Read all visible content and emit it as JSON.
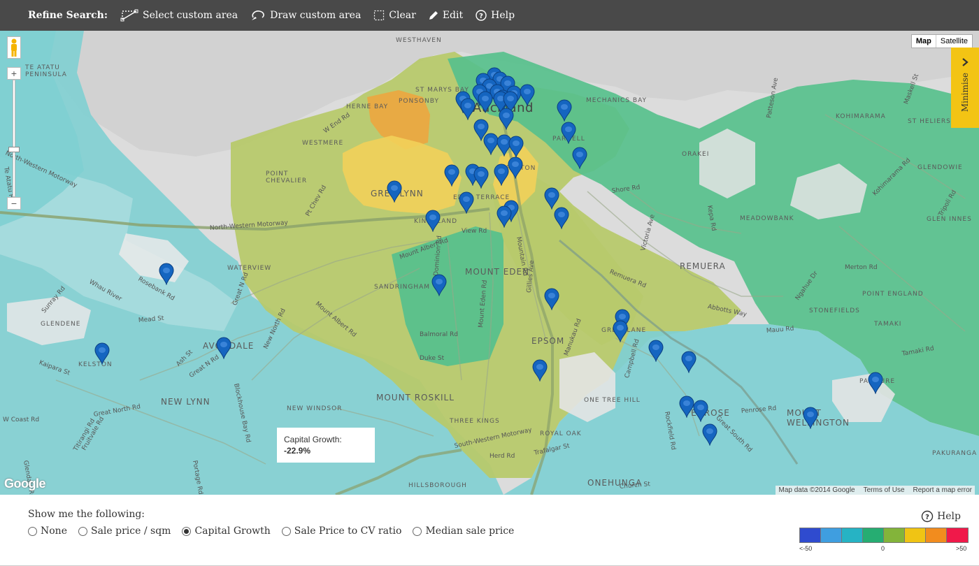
{
  "toolbar": {
    "title": "Refine Search:",
    "tools": [
      {
        "label": "Select custom area",
        "icon": "select-area-icon"
      },
      {
        "label": "Draw custom area",
        "icon": "draw-area-icon"
      },
      {
        "label": "Clear",
        "icon": "clear-icon"
      },
      {
        "label": "Edit",
        "icon": "pencil-icon"
      },
      {
        "label": "Help",
        "icon": "help-icon"
      }
    ]
  },
  "map": {
    "map_type": {
      "map": "Map",
      "satellite": "Satellite",
      "selected": "Map"
    },
    "minimise_label": "Minimise",
    "zoom": {
      "in": "+",
      "out": "−"
    },
    "tooltip": {
      "label": "Capital Growth:",
      "value": "-22.9%"
    },
    "google_logo": "Google",
    "attribution": [
      "Map data ©2014 Google",
      "Terms of Use",
      "Report a map error"
    ],
    "places": {
      "auckland": "Auckland",
      "grey_lynn": "GREY LYNN",
      "mount_eden": "MOUNT EDEN",
      "remuera": "REMUERA",
      "avondale": "AVONDALE",
      "new_lynn": "NEW LYNN",
      "mount_roskill": "MOUNT ROSKILL",
      "mount_wellington": "MOUNT\nWELLINGTON",
      "epsom": "EPSOM",
      "penrose": "PENROSE",
      "ponsonby": "PONSONBY",
      "westmere": "WESTMERE",
      "parnell": "PARNELL",
      "grafton": "GRAFTON",
      "eden_terrace": "EDEN TERRACE",
      "kingsland": "KINGSLAND",
      "sandringham": "SANDRINGHAM",
      "greenlane": "GREENLANE",
      "one_tree_hill": "ONE TREE HILL",
      "three_kings": "THREE KINGS",
      "royal_oak": "ROYAL OAK",
      "onehunga": "ONEHUNGA",
      "hillsborough": "HILLSBOROUGH",
      "new_windsor": "NEW WINDSOR",
      "kelston": "KELSTON",
      "glendene": "GLENDENE",
      "waterview": "WATERVIEW",
      "point_chevalier": "POINT\nCHEVALIER",
      "te_atatu_peninsula": "TE ATATU\nPENINSULA",
      "westhaven": "WESTHAVEN",
      "herne_bay": "HERNE BAY",
      "st_marys_bay": "ST MARYS BAY",
      "mechanics_bay": "MECHANICS BAY",
      "orakei": "ORAKEI",
      "kohimarama": "KOHIMARAMA",
      "st_heliers": "ST HELIERS",
      "glendowie": "GLENDOWIE",
      "meadowbank": "MEADOWBANK",
      "stonefields": "STONEFIELDS",
      "point_england": "POINT ENGLAND",
      "panmure": "PANMURE",
      "glen_innes": "GLEN INNES",
      "pakuranga": "PAKURANGA",
      "tamaki": "TAMAKI"
    },
    "streets": {
      "nw_motorway_1": "North-Western Motorway",
      "nw_motorway_2": "North-Western Motorway",
      "great_north_rd": "Great N Rd",
      "great_north_rd_2": "Great N Rd",
      "great_north_rd_3": "Great North Rd",
      "new_north_rd": "New North Rd",
      "mount_albert_rd": "Mount Albert Rd",
      "dominion_rd": "Dominion Rd",
      "mount_eden_rd": "Mount Eden Rd",
      "gillies_ave": "Gillies Ave",
      "manukau_rd": "Manukau Rd",
      "mountain_rd": "Mountain Rd",
      "remuera_rd": "Remuera Rd",
      "shore_rd": "Shore Rd",
      "victoria_ave": "Victoria Ave",
      "abbotts_way": "Abbotts Way",
      "campbell_rd": "Campbell Rd",
      "penrose_rd": "Penrose Rd",
      "mount_albert_rd_2": "Mount Albert Rd",
      "view_rd": "View Rd",
      "balmoral": "Balmoral Rd",
      "duke_st": "Duke St",
      "herd_rd": "Herd Rd",
      "trafalgar_st": "Trafalgar St",
      "church_st": "Church St",
      "merton_rd": "Merton Rd",
      "tamaki_rd": "Tamaki Rd",
      "rosebank_rd": "Rosebank Rd",
      "whau_river": "Whau River",
      "ash_st": "Ash St",
      "blockhouse_bay_rd": "Blockhouse Bay Rd",
      "sw_motorway": "South-Western Motorway",
      "patteson_ave": "Patteson Ave",
      "kepa_rd": "Kepa Rd",
      "maskell_st": "Maskell St",
      "kohimarama_rd": "Kohimarama Rd",
      "tripoli_rd": "Tripoli Rd",
      "ngahue_dr": "Ngahue Dr",
      "west_end_rd": "W End Rd",
      "te_atatu_rd": "Te Atatu Rd",
      "titirangi_rd": "Titirangi Rd",
      "maunu_rd": "Mauu Rd",
      "rockfield_rd": "Rockfield Rd",
      "great_south_rd": "Great South Rd",
      "mead_st": "Mead St",
      "sunray_rd": "Sunray Rd",
      "glendale_rd": "Glendale Rd",
      "portage_rd": "Portage Rd",
      "fruitvale_rd": "Fruitvale Rd",
      "w_coast_rd": "W Coast Rd",
      "kaipara_st": "Kaipara St",
      "pt_chev_rd": "Pt Chev Rd"
    }
  },
  "controls": {
    "heading": "Show me the following:",
    "options": [
      "None",
      "Sale price / sqm",
      "Capital Growth",
      "Sale Price to CV ratio",
      "Median sale price"
    ],
    "selected": "Capital Growth",
    "help_label": "Help",
    "legend": {
      "colors": [
        "#2f4bcf",
        "#3f9ee0",
        "#26b3c4",
        "#26ad72",
        "#83b43a",
        "#f0c414",
        "#f28c1e",
        "#f0194a"
      ],
      "labels": {
        "min": "<-50",
        "mid": "0",
        "max": ">50"
      }
    }
  }
}
